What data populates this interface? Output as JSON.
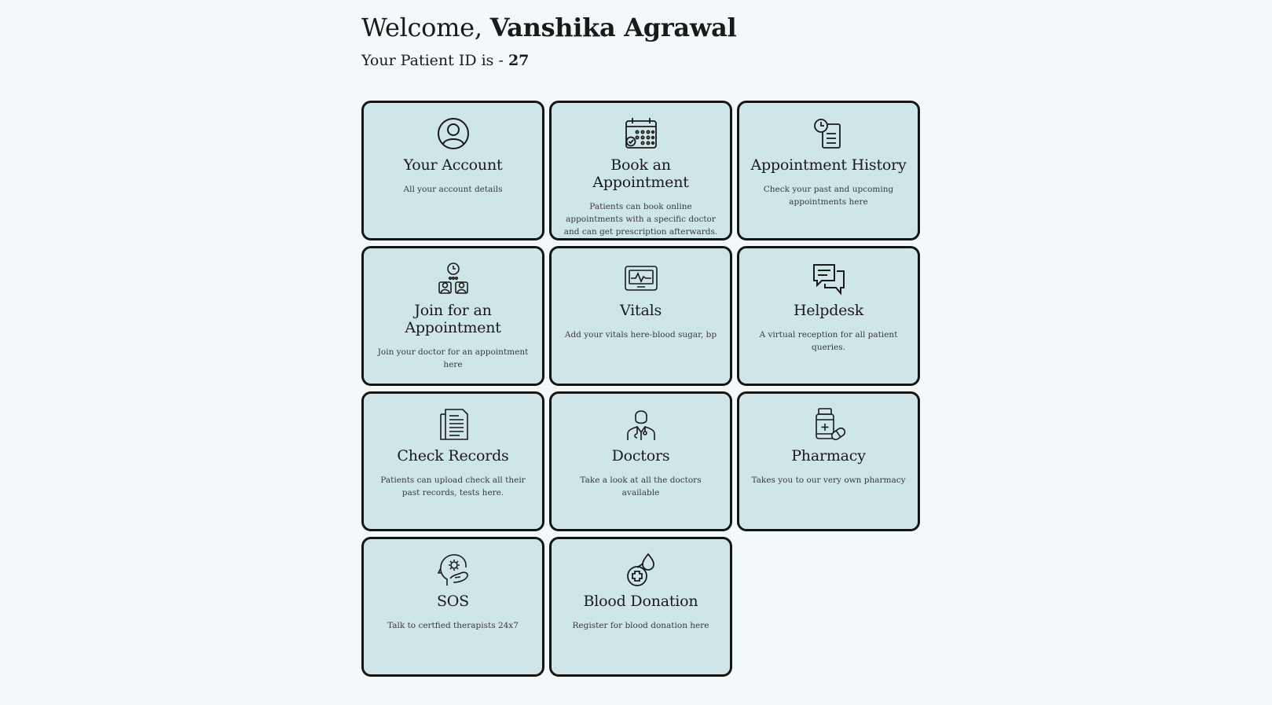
{
  "header": {
    "welcome_prefix": "Welcome,",
    "user_name": "Vanshika Agrawal",
    "patient_id_label": "Your Patient ID is -",
    "patient_id": "27"
  },
  "colors": {
    "background": "#f3f9fa",
    "card_background": "#cfe6e8",
    "card_border": "#151515"
  },
  "cards": [
    {
      "icon": "user-circle-icon",
      "title": "Your Account",
      "description": "All your account details"
    },
    {
      "icon": "calendar-icon",
      "title": "Book an Appointment",
      "description": "Patients can book online appointments with a specific doctor and can get prescription afterwards."
    },
    {
      "icon": "clock-clipboard-icon",
      "title": "Appointment History",
      "description": "Check your past and upcoming appointments here"
    },
    {
      "icon": "video-consultation-icon",
      "title": "Join for an Appointment",
      "description": "Join your doctor for an appointment here"
    },
    {
      "icon": "heart-monitor-icon",
      "title": "Vitals",
      "description": "Add your vitals here-blood sugar, bp"
    },
    {
      "icon": "chat-bubbles-icon",
      "title": "Helpdesk",
      "description": "A virtual reception for all patient queries."
    },
    {
      "icon": "document-icon",
      "title": "Check Records",
      "description": "Patients can upload check all their past records, tests here."
    },
    {
      "icon": "doctor-icon",
      "title": "Doctors",
      "description": "Take a look at all the doctors available"
    },
    {
      "icon": "medicine-bottle-icon",
      "title": "Pharmacy",
      "description": "Takes you to our very own pharmacy"
    },
    {
      "icon": "mental-health-icon",
      "title": "SOS",
      "description": "Talk to certfied therapists 24x7"
    },
    {
      "icon": "blood-drop-icon",
      "title": "Blood Donation",
      "description": "Register for blood donation here"
    }
  ]
}
